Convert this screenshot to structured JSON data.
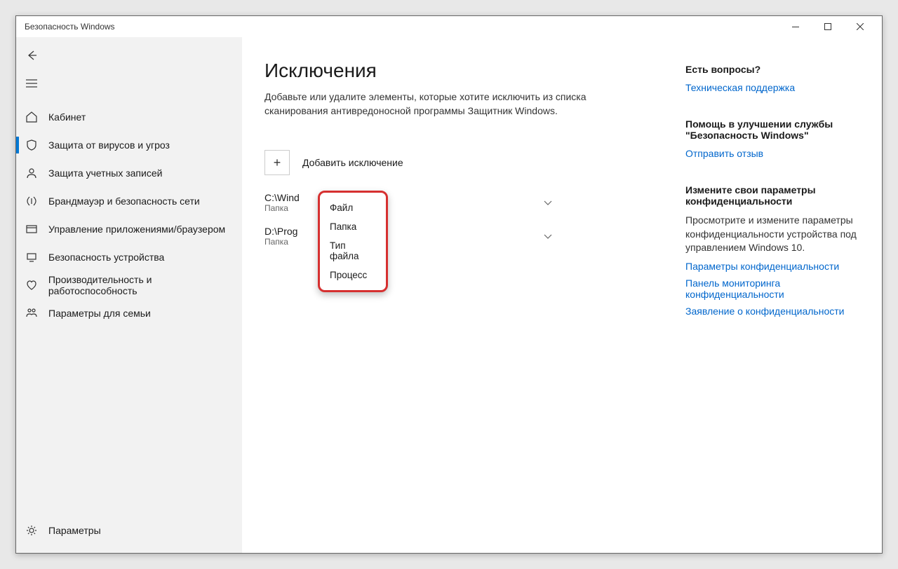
{
  "window": {
    "title": "Безопасность Windows"
  },
  "sidebar": {
    "items": [
      {
        "label": "Кабинет"
      },
      {
        "label": "Защита от вирусов и угроз"
      },
      {
        "label": "Защита учетных записей"
      },
      {
        "label": "Брандмауэр и безопасность сети"
      },
      {
        "label": "Управление приложениями/браузером"
      },
      {
        "label": "Безопасность устройства"
      },
      {
        "label": "Производительность и работоспособность"
      },
      {
        "label": "Параметры для семьи"
      }
    ],
    "footer": {
      "label": "Параметры"
    }
  },
  "main": {
    "title": "Исключения",
    "description": "Добавьте или удалите элементы, которые хотите исключить из списка сканирования антивредоносной программы Защитник Windows.",
    "add_button": "Добавить исключение",
    "exclusions": [
      {
        "path": "C:\\Wind",
        "type": "Папка"
      },
      {
        "path": "D:\\Prog",
        "type": "Папка"
      }
    ],
    "dropdown": {
      "items": [
        "Файл",
        "Папка",
        "Тип файла",
        "Процесс"
      ]
    }
  },
  "aside": {
    "sections": [
      {
        "heading": "Есть вопросы?",
        "links": [
          "Техническая поддержка"
        ]
      },
      {
        "heading": "Помощь в улучшении службы \"Безопасность Windows\"",
        "links": [
          "Отправить отзыв"
        ]
      },
      {
        "heading": "Измените свои параметры конфиденциальности",
        "body": "Просмотрите и измените параметры конфиденциальности устройства под управлением Windows 10.",
        "links": [
          "Параметры конфиденциальности",
          "Панель мониторинга конфиденциальности",
          "Заявление о конфиденциальности"
        ]
      }
    ]
  }
}
